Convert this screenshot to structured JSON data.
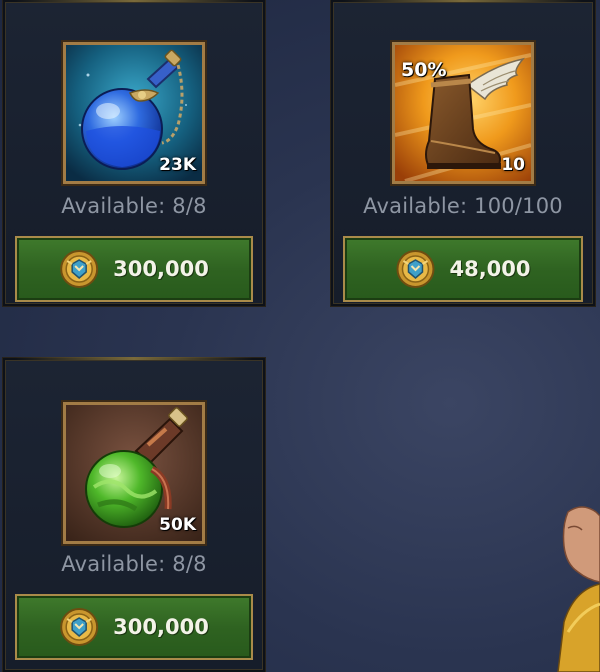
{
  "shop": {
    "items": [
      {
        "name": "Blue Potion",
        "icon": "blue-potion-icon",
        "quantity": "23K",
        "available_label": "Available: 8/8",
        "price": "300,000",
        "currency_icon": "gold-coin-icon"
      },
      {
        "name": "Winged Boot",
        "icon": "winged-boot-icon",
        "quantity": "10",
        "discount": "50%",
        "available_label": "Available: 100/100",
        "price": "48,000",
        "currency_icon": "gold-coin-icon"
      },
      {
        "name": "Green Potion",
        "icon": "green-potion-icon",
        "quantity": "50K",
        "available_label": "Available: 8/8",
        "price": "300,000",
        "currency_icon": "gold-coin-icon"
      }
    ]
  },
  "colors": {
    "button_green": "#2f6321",
    "frame_gold": "#a27c46",
    "available_text": "#8e96a3",
    "panel_bg": "#1c2433"
  }
}
